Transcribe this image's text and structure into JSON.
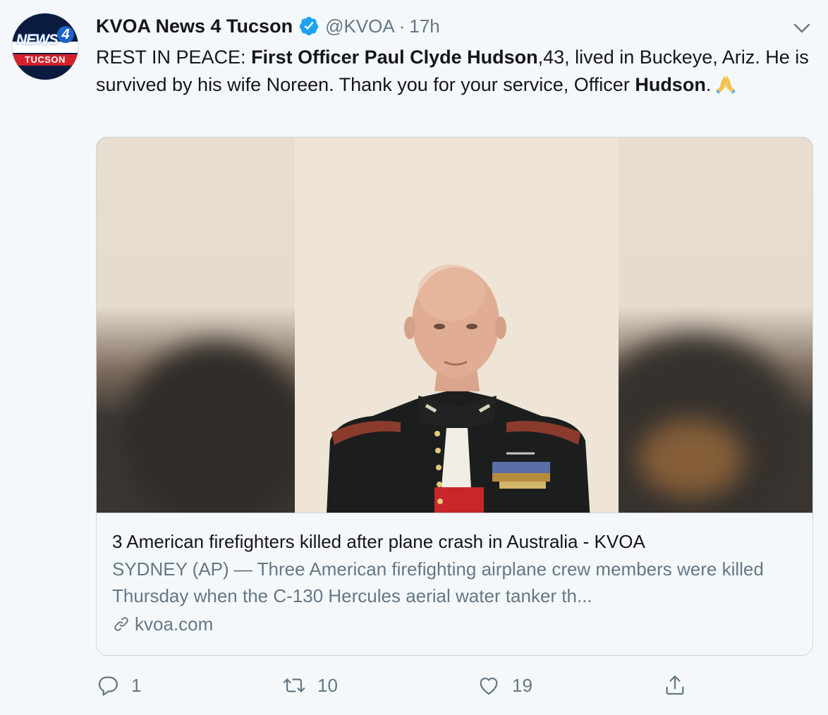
{
  "tweet": {
    "display_name": "KVOA News 4 Tucson",
    "handle": "@KVOA",
    "separator": "·",
    "time": "17h",
    "verified": true,
    "text": {
      "part1": "REST IN PEACE: ",
      "bold1": "First Officer Paul Clyde Hudson",
      "part2": ",43, lived in Buckeye, Ariz. He is survived by his wife Noreen. Thank you for your service, Officer ",
      "bold2": "Hudson",
      "part3": ".",
      "emoji": "folded-hands-emoji"
    }
  },
  "avatar": {
    "logo_top": "NEWS",
    "logo_number": "4",
    "logo_city": "TUCSON"
  },
  "card": {
    "title": "3 American firefighters killed after plane crash in Australia - KVOA",
    "description": "SYDNEY (AP) — Three American firefighting airplane crew members were killed Thursday when the C-130 Hercules aerial water tanker th...",
    "domain": "kvoa.com",
    "image_subject": "portrait-photo"
  },
  "actions": {
    "reply_count": "1",
    "retweet_count": "10",
    "like_count": "19"
  },
  "colors": {
    "verified": "#1da1f2",
    "secondary_text": "#657786",
    "card_border": "#ccd6dd",
    "background": "#f5f8fa"
  }
}
